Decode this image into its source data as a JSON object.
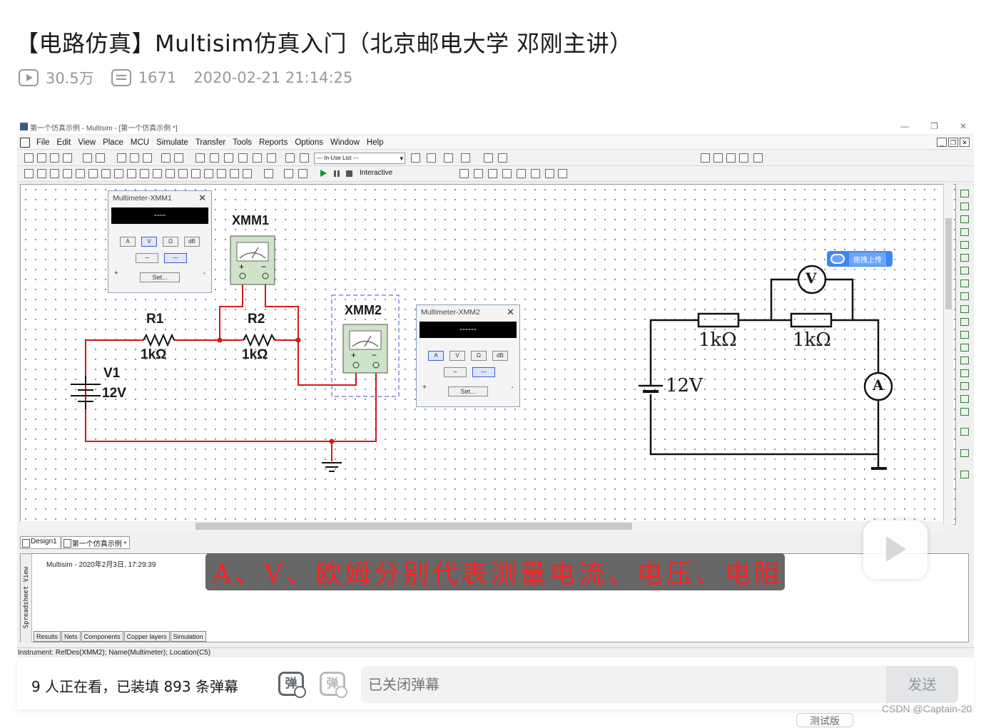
{
  "page": {
    "title": "【电路仿真】Multisim仿真入门（北京邮电大学 邓刚主讲）",
    "views": "30.5万",
    "danmaku_count": "1671",
    "datetime": "2020-02-21 21:14:25"
  },
  "window": {
    "title": "第一个仿真示例 - Multisim - [第一个仿真示例 *]",
    "menus": [
      "File",
      "Edit",
      "View",
      "Place",
      "MCU",
      "Simulate",
      "Transfer",
      "Tools",
      "Reports",
      "Options",
      "Window",
      "Help"
    ],
    "inuse_list": "--- In-Use List ---",
    "interactive_label": "Interactive",
    "upload_badge": "拖拽上传"
  },
  "schematic": {
    "xmm1": "XMM1",
    "xmm2": "XMM2",
    "r1": "R1",
    "r1_value": "1kΩ",
    "r2": "R2",
    "r2_value": "1kΩ",
    "v1": "V1",
    "v1_value": "12V"
  },
  "multimeter1": {
    "title": "Multimeter-XMM1",
    "display": "----",
    "buttons": [
      "A",
      "V",
      "Ω",
      "dB"
    ],
    "set_label": "Set...",
    "plus": "+",
    "minus": "-"
  },
  "multimeter2": {
    "title": "Multimeter-XMM2",
    "display": "------",
    "buttons": [
      "A",
      "V",
      "Ω",
      "dB"
    ],
    "set_label": "Set...",
    "plus": "+",
    "minus": "-"
  },
  "diagram": {
    "r_left": "1kΩ",
    "r_right": "1kΩ",
    "source": "12V",
    "voltmeter": "V",
    "ammeter": "A"
  },
  "doc_tabs": [
    "Design1",
    "第一个仿真示例 *"
  ],
  "spreadsheet": {
    "side_label": "Spreadsheet View",
    "log_line": "Multisim  -  2020年2月3日, 17:29:39",
    "tabs": [
      "Results",
      "Nets",
      "Components",
      "Copper layers",
      "Simulation"
    ]
  },
  "status_bar": "Instrument: RefDes(XMM2); Name(Multimeter); Location(C5)",
  "subtitle": "A、V、欧姆分别代表测量电流、电压、电阻",
  "bottom": {
    "viewers": "9 人正在看，已装填 893 条弹幕",
    "toggle_on": "弹",
    "toggle_off": "弹",
    "input_placeholder": "已关闭弹幕",
    "send_label": "发送",
    "beta_label": "测试版"
  },
  "watermark": "CSDN @Captain-20",
  "colors": {
    "wire_red": "#d21a1a",
    "wire_black": "#111111",
    "accent": "#3c86f4",
    "instrument_green": "#cfe3c9"
  }
}
